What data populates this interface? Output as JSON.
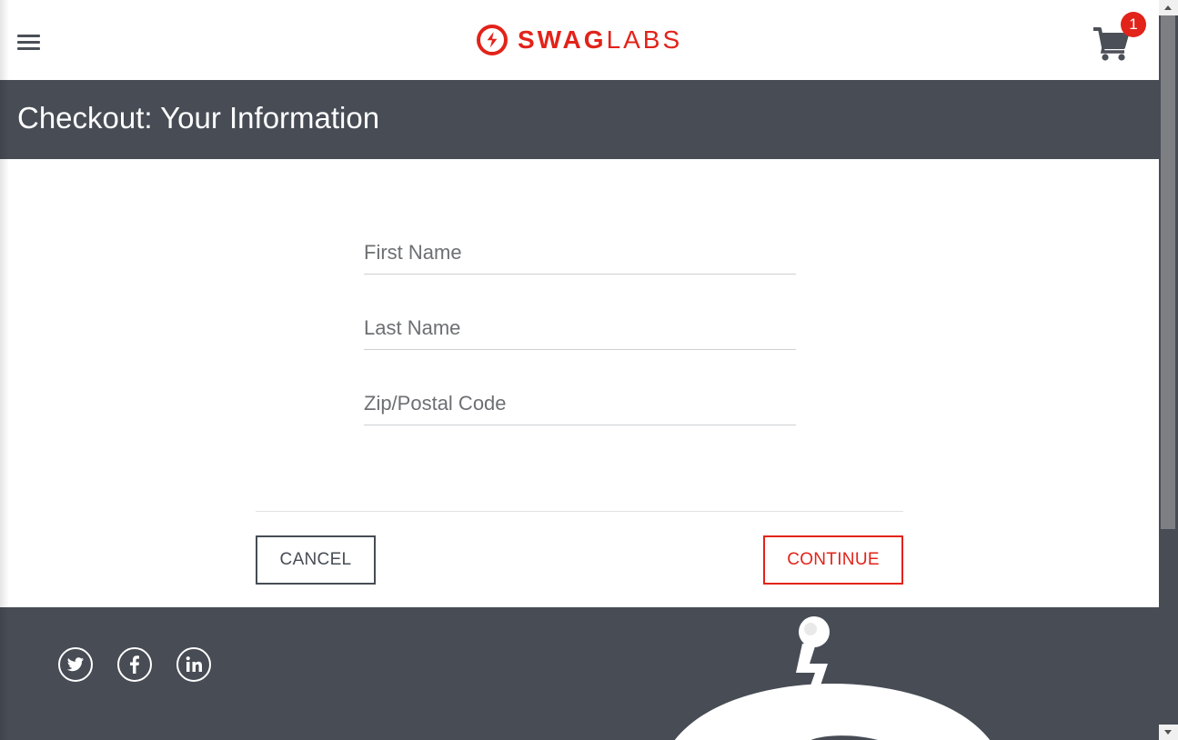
{
  "app": {
    "brand_bold": "SWAG",
    "brand_light": "LABS",
    "brand_color": "#e2231a"
  },
  "header": {
    "menu_icon": "hamburger-menu-icon",
    "cart_icon": "shopping-cart-icon",
    "cart_count": "1"
  },
  "page": {
    "title": "Checkout: Your Information",
    "title_bar_color": "#474c55"
  },
  "form": {
    "first_name": {
      "value": "",
      "placeholder": "First Name"
    },
    "last_name": {
      "value": "",
      "placeholder": "Last Name"
    },
    "postal_code": {
      "value": "",
      "placeholder": "Zip/Postal Code"
    }
  },
  "actions": {
    "cancel_label": "CANCEL",
    "continue_label": "CONTINUE"
  },
  "footer": {
    "social": [
      "twitter-icon",
      "facebook-icon",
      "linkedin-icon"
    ],
    "mascot": "swag-bot-robot-graphic",
    "background_color": "#474c55"
  }
}
